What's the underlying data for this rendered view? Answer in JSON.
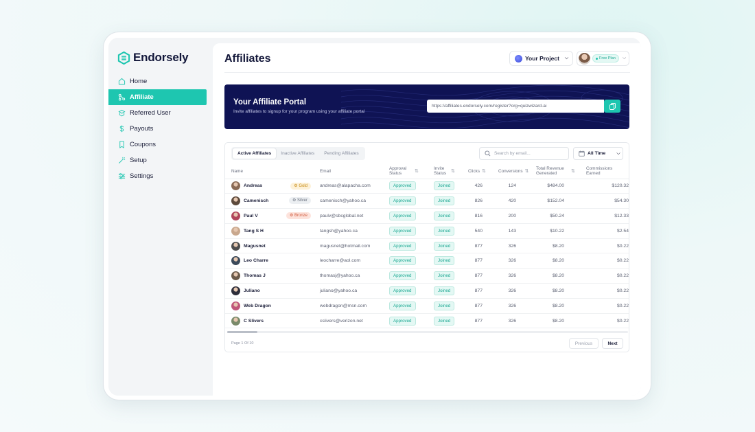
{
  "brand": {
    "name": "Endorsely"
  },
  "sidebar": {
    "items": [
      {
        "label": "Home",
        "icon": "home-icon"
      },
      {
        "label": "Affiliate",
        "icon": "affiliate-icon",
        "active": true
      },
      {
        "label": "Referred User",
        "icon": "referred-user-icon"
      },
      {
        "label": "Payouts",
        "icon": "dollar-icon"
      },
      {
        "label": "Coupons",
        "icon": "coupon-icon"
      },
      {
        "label": "Setup",
        "icon": "wand-icon"
      },
      {
        "label": "Settings",
        "icon": "sliders-icon"
      }
    ]
  },
  "header": {
    "title": "Affiliates",
    "project_label": "Your Project",
    "plan_label": "Free Plan"
  },
  "banner": {
    "title": "Your Affiliate Portal",
    "subtitle": "Invite affiliates to signup for your program using your affiliate portal",
    "url": "https://affiliates.endorsely.com/register?org=quizwizard-ai"
  },
  "table": {
    "tabs": [
      "Active Affiliates",
      "Inactive Affiliates",
      "Pending Affiliates"
    ],
    "search_placeholder": "Search by email...",
    "range_label": "All Time",
    "columns": [
      "Name",
      "Email",
      "Approval Status",
      "Invite Status",
      "Clicks",
      "Conversions",
      "Total Revenue Generated",
      "Commissions Earned"
    ],
    "rows": [
      {
        "name": "Andreas",
        "tier": "Gold",
        "email": "andreas@alapacha.com",
        "approval": "Approved",
        "invite": "Joined",
        "clicks": "426",
        "conversions": "124",
        "revenue": "$484.00",
        "commission": "$120.32"
      },
      {
        "name": "Camenisch",
        "tier": "Silver",
        "email": "camenisch@yahoo.ca",
        "approval": "Approved",
        "invite": "Joined",
        "clicks": "826",
        "conversions": "420",
        "revenue": "$152.04",
        "commission": "$54.30"
      },
      {
        "name": "Paul V",
        "tier": "Bronze",
        "email": "paulv@sbcglobal.net",
        "approval": "Approved",
        "invite": "Joined",
        "clicks": "816",
        "conversions": "200",
        "revenue": "$50.24",
        "commission": "$12.33"
      },
      {
        "name": "Tang S H",
        "tier": "",
        "email": "tangsh@yahoo.ca",
        "approval": "Approved",
        "invite": "Joined",
        "clicks": "540",
        "conversions": "143",
        "revenue": "$10.22",
        "commission": "$2.54"
      },
      {
        "name": "Magusnet",
        "tier": "",
        "email": "magusnet@hotmail.com",
        "approval": "Approved",
        "invite": "Joined",
        "clicks": "877",
        "conversions": "326",
        "revenue": "$8.20",
        "commission": "$0.22"
      },
      {
        "name": "Leo Charre",
        "tier": "",
        "email": "leocharre@aol.com",
        "approval": "Approved",
        "invite": "Joined",
        "clicks": "877",
        "conversions": "326",
        "revenue": "$8.20",
        "commission": "$0.22"
      },
      {
        "name": "Thomas J",
        "tier": "",
        "email": "thomasj@yahoo.ca",
        "approval": "Approved",
        "invite": "Joined",
        "clicks": "877",
        "conversions": "326",
        "revenue": "$8.20",
        "commission": "$0.22"
      },
      {
        "name": "Juliano",
        "tier": "",
        "email": "juliano@yahoo.ca",
        "approval": "Approved",
        "invite": "Joined",
        "clicks": "877",
        "conversions": "326",
        "revenue": "$8.20",
        "commission": "$0.22"
      },
      {
        "name": "Web Dragon",
        "tier": "",
        "email": "webdragon@msn.com",
        "approval": "Approved",
        "invite": "Joined",
        "clicks": "877",
        "conversions": "326",
        "revenue": "$8.20",
        "commission": "$0.22"
      },
      {
        "name": "C Slivers",
        "tier": "",
        "email": "cslivers@verizon.net",
        "approval": "Approved",
        "invite": "Joined",
        "clicks": "877",
        "conversions": "326",
        "revenue": "$8.20",
        "commission": "$0.22"
      }
    ],
    "page_info": "Page 1 Of 10",
    "prev_label": "Previous",
    "next_label": "Next"
  },
  "colors": {
    "accent": "#1ec6b0",
    "banner": "#0f1354",
    "text": "#1c1f3a"
  }
}
